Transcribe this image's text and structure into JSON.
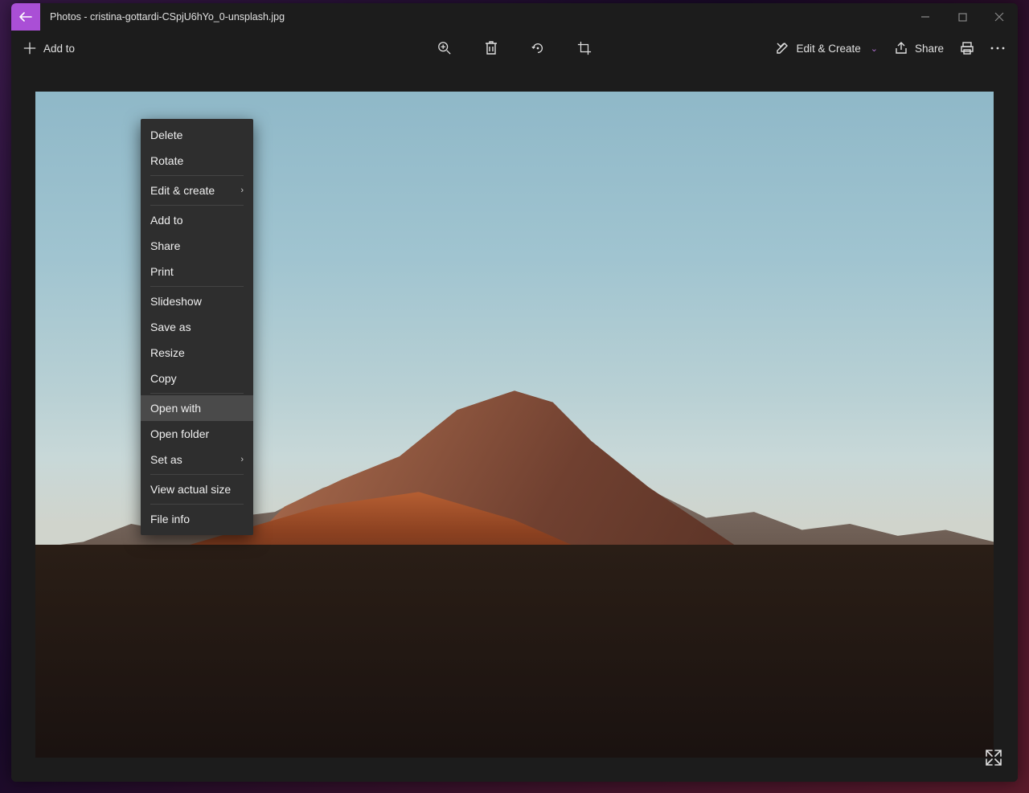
{
  "titlebar": {
    "title": "Photos - cristina-gottardi-CSpjU6hYo_0-unsplash.jpg"
  },
  "toolbar": {
    "add_to": "Add to",
    "edit_create": "Edit & Create",
    "share": "Share"
  },
  "context_menu": {
    "items": [
      {
        "label": "Delete"
      },
      {
        "label": "Rotate"
      },
      {
        "sep": true
      },
      {
        "label": "Edit & create",
        "submenu": true
      },
      {
        "sep": true
      },
      {
        "label": "Add to"
      },
      {
        "label": "Share"
      },
      {
        "label": "Print"
      },
      {
        "sep": true
      },
      {
        "label": "Slideshow"
      },
      {
        "label": "Save as"
      },
      {
        "label": "Resize"
      },
      {
        "label": "Copy"
      },
      {
        "sep": true
      },
      {
        "label": "Open with",
        "selected": true
      },
      {
        "label": "Open folder"
      },
      {
        "label": "Set as",
        "submenu": true
      },
      {
        "sep": true
      },
      {
        "label": "View actual size"
      },
      {
        "sep": true
      },
      {
        "label": "File info"
      }
    ]
  }
}
